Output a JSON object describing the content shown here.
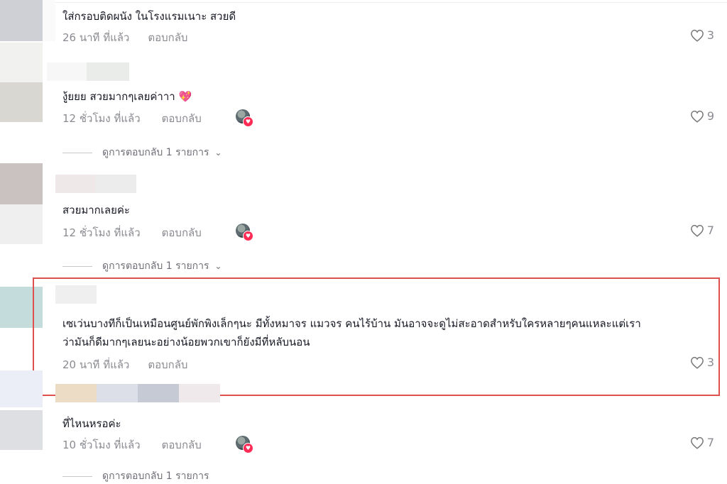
{
  "comments": [
    {
      "text": "ใส่กรอบติดผนัง ในโรงแรมเนาะ สวยดี",
      "time": "26 นาที ที่แล้ว",
      "reply": "ตอบกลับ",
      "likes": "3"
    },
    {
      "text": "งู้ยยย สวยมากๆเลยค่าาา",
      "emoji": "💖",
      "time": "12 ชั่วโมง ที่แล้ว",
      "reply": "ตอบกลับ",
      "likes": "9",
      "view_replies": "ดูการตอบกลับ 1 รายการ"
    },
    {
      "text": "สวยมากเลยค่ะ",
      "time": "12 ชั่วโมง ที่แล้ว",
      "reply": "ตอบกลับ",
      "likes": "7",
      "view_replies": "ดูการตอบกลับ 1 รายการ"
    },
    {
      "text_line1": "เซเว่นบางทีก็เป็นเหมือนศูนย์พักพิงเล็กๆนะ มีทั้งหมาจร แมวจร คนไร้บ้าน มันอาจจะดูไม่สะอาดสำหรับใครหลายๆคนแหละแต่เรา",
      "text_line2": "ว่ามันก็ดีมากๆเลยนะอย่างน้อยพวกเขาก็ยังมีที่หลับนอน",
      "time": "20 นาที ที่แล้ว",
      "reply": "ตอบกลับ",
      "likes": "3"
    },
    {
      "text": "ที่ไหนหรอค่ะ",
      "time": "10 ชั่วโมง ที่แล้ว",
      "reply": "ตอบกลับ",
      "likes": "7",
      "view_replies": "ดูการตอบกลับ 1 รายการ"
    }
  ],
  "colors": {
    "highlight_border": "#e0504f",
    "creator_badge": "#fe2c55",
    "meta_text": "#8a8b91"
  }
}
